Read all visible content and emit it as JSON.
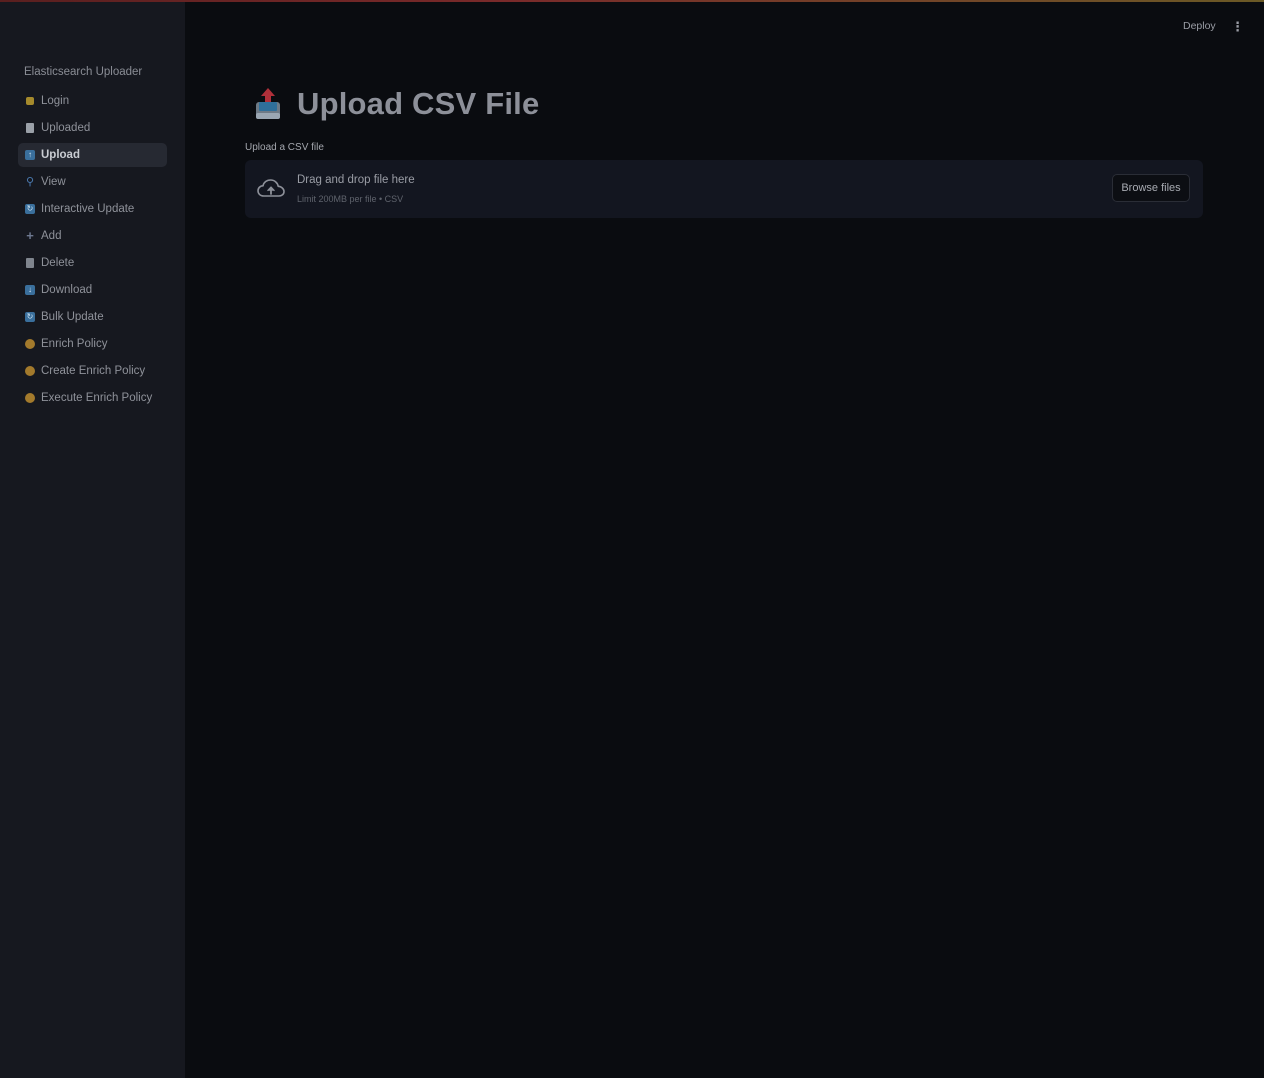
{
  "header": {
    "deploy_label": "Deploy",
    "menu_icon": "vertical-dots-icon"
  },
  "sidebar": {
    "title": "Elasticsearch Uploader",
    "items": [
      {
        "label": "Login",
        "icon": "lock-icon",
        "active": false
      },
      {
        "label": "Uploaded",
        "icon": "document-icon",
        "active": false
      },
      {
        "label": "Upload",
        "icon": "upload-box-icon",
        "active": true
      },
      {
        "label": "View",
        "icon": "magnifier-icon",
        "active": false
      },
      {
        "label": "Interactive Update",
        "icon": "refresh-box-icon",
        "active": false
      },
      {
        "label": "Add",
        "icon": "plus-icon",
        "active": false
      },
      {
        "label": "Delete",
        "icon": "trash-icon",
        "active": false
      },
      {
        "label": "Download",
        "icon": "download-box-icon",
        "active": false
      },
      {
        "label": "Bulk Update",
        "icon": "refresh-box-icon",
        "active": false
      },
      {
        "label": "Enrich Policy",
        "icon": "orange-circle-icon",
        "active": false
      },
      {
        "label": "Create Enrich Policy",
        "icon": "orange-circle-icon",
        "active": false
      },
      {
        "label": "Execute Enrich Policy",
        "icon": "orange-circle-icon",
        "active": false
      }
    ]
  },
  "main": {
    "title": "Upload CSV File",
    "title_icon": "outbox-tray-icon",
    "uploader": {
      "label": "Upload a CSV file",
      "drop_text": "Drag and drop file here",
      "limit_text": "Limit 200MB per file • CSV",
      "browse_label": "Browse files",
      "icon": "cloud-upload-icon"
    }
  },
  "colors": {
    "background": "#0a0c10",
    "sidebar": "#16181f",
    "accent_top": "#7a2a2a"
  }
}
